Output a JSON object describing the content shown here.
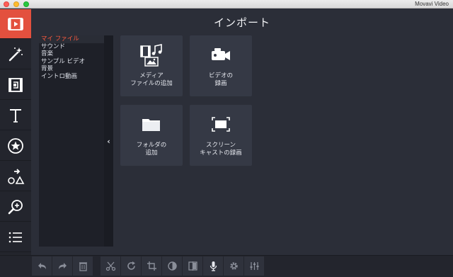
{
  "window": {
    "title": "Movavi Video"
  },
  "header": {
    "title": "インポート"
  },
  "sidebar": {
    "tools": [
      {
        "name": "import-tool",
        "icon": "film-import-icon",
        "active": true
      },
      {
        "name": "filters-tool",
        "icon": "magic-wand-icon",
        "active": false
      },
      {
        "name": "transitions-tool",
        "icon": "transition-film-icon",
        "active": false
      },
      {
        "name": "titles-tool",
        "icon": "text-t-icon",
        "active": false
      },
      {
        "name": "stickers-tool",
        "icon": "star-sticker-icon",
        "active": false
      },
      {
        "name": "callouts-tool",
        "icon": "shapes-icon",
        "active": false
      },
      {
        "name": "zoom-tool",
        "icon": "zoom-in-icon",
        "active": false
      },
      {
        "name": "more-tool",
        "icon": "list-icon",
        "active": false
      }
    ]
  },
  "categories": {
    "items": [
      {
        "label": "マイ ファイル",
        "active": true
      },
      {
        "label": "サウンド",
        "active": false
      },
      {
        "label": "音楽",
        "active": false
      },
      {
        "label": "サンプル ビデオ",
        "active": false
      },
      {
        "label": "背景",
        "active": false
      },
      {
        "label": "イントロ動画",
        "active": false
      }
    ],
    "collapse_glyph": "‹"
  },
  "tiles": {
    "add_media": {
      "line1": "メディア",
      "line2": "ファイルの追加"
    },
    "record_video": {
      "line1": "ビデオの",
      "line2": "録画"
    },
    "add_folder": {
      "line1": "フォルダの",
      "line2": "追加"
    },
    "screencast": {
      "line1": "スクリーン",
      "line2": "キャストの録画"
    }
  },
  "bottom_tools": {
    "group1": [
      "undo-icon",
      "redo-icon",
      "trash-icon"
    ],
    "group2": [
      "scissors-icon",
      "rotate-icon",
      "crop-icon",
      "color-adjust-icon",
      "split-icon",
      "microphone-icon",
      "settings-icon",
      "equalizer-icon"
    ]
  },
  "colors": {
    "accent": "#e3503e",
    "active_category": "#ff5a40",
    "tile": "#353945",
    "background": "#2b2e38"
  }
}
